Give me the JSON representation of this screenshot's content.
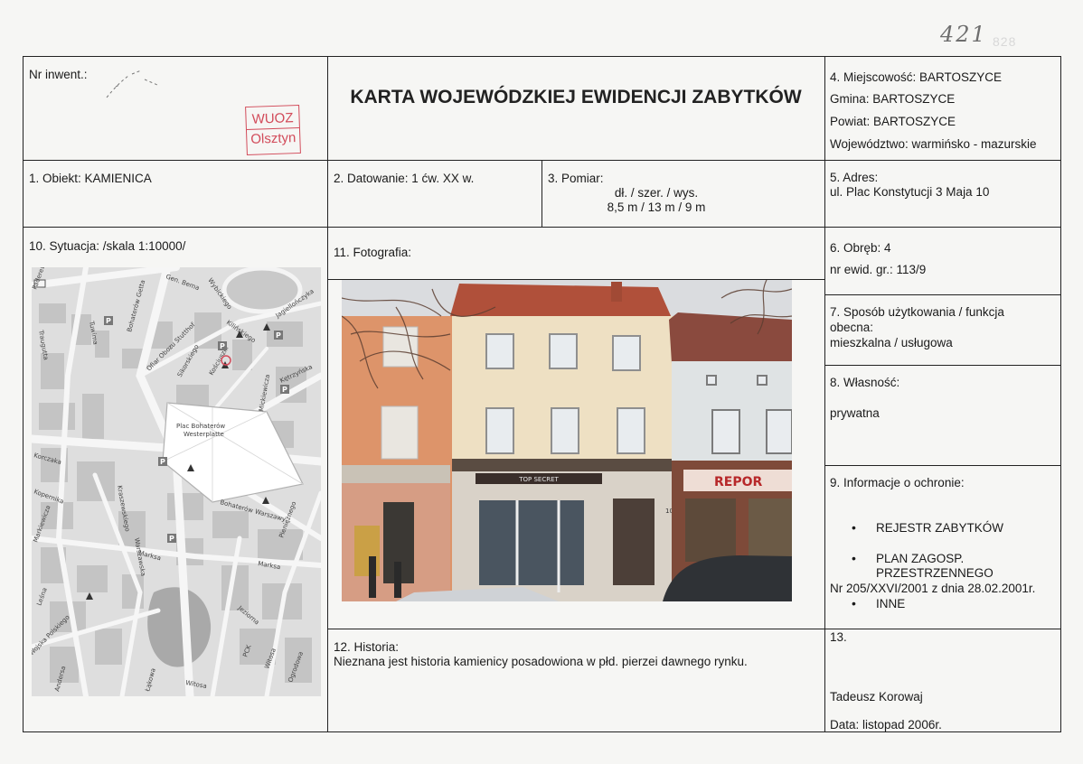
{
  "page_number": "421",
  "page_number_faint": "828",
  "title": "KARTA WOJEWÓDZKIEJ EWIDENCJI ZABYTKÓW",
  "stamp": {
    "line1": "WUOZ",
    "line2": "Olsztyn"
  },
  "inventory": {
    "label": "Nr inwent.:"
  },
  "location": {
    "miejscowosc": "4. Miejscowość: BARTOSZYCE",
    "gmina": "Gmina: BARTOSZYCE",
    "powiat": "Powiat: BARTOSZYCE",
    "wojewodztwo": "Województwo: warmińsko - mazurskie"
  },
  "object": "1. Obiekt: KAMIENICA",
  "dating": "2. Datowanie: 1 ćw. XX w.",
  "measure": {
    "label": "3. Pomiar:",
    "dims_label": "dł. / szer. / wys.",
    "dims_value": "8,5 m / 13 m / 9 m"
  },
  "address": {
    "label": "5. Adres:",
    "value": "ul. Plac Konstytucji 3 Maja 10"
  },
  "situation": "10. Sytuacja: /skala 1:10000/",
  "photo_label": "11. Fotografia:",
  "precinct": {
    "label": "6. Obręb: 4",
    "parcel": "nr ewid. gr.: 113/9"
  },
  "usage": {
    "label_line1": "7. Sposób użytkowania / funkcja",
    "label_line2": "obecna:",
    "value": "mieszkalna / usługowa"
  },
  "ownership": {
    "label": "8. Własność:",
    "value": "prywatna"
  },
  "protection": {
    "label": "9. Informacje o ochronie:",
    "item1": "REJESTR ZABYTKÓW",
    "item2_line1": "PLAN ZAGOSP.",
    "item2_line2": "PRZESTRZENNEGO",
    "resolution": "Nr 205/XXVI/2001 z dnia 28.02.2001r.",
    "item3": "INNE"
  },
  "history": {
    "label": "12. Historia:",
    "text": "Nieznana jest historia kamienicy posadowiona w płd. pierzei dawnego rynku."
  },
  "field13": {
    "label": "13.",
    "author": "Tadeusz Korowaj",
    "date": "Data: listopad 2006r."
  },
  "map": {
    "streets": [
      "Paderewskiego",
      "Gen. Bema",
      "Wybickiego",
      "Kilińskiego",
      "Jagiellończyka",
      "Tuwima",
      "Traugutta",
      "Bohaterów Getta",
      "Ofiar Obozu Stutthof",
      "Sikorskiego",
      "Kościuszki",
      "Kętrzyńska",
      "Mickiewicza",
      "Plac Bohaterów Westerplatte",
      "Korczaka",
      "Bohaterów Warszawy",
      "Kraszewskiego",
      "Kopernika",
      "Jezdna",
      "Warszawska",
      "Markiewicza",
      "Marksa",
      "Leśna",
      "Jeziorna",
      "Pieniężnego",
      "Wojska Polskiego",
      "Andersa",
      "Witosa",
      "PCK",
      "Ogrodowa",
      "Łąkowa"
    ]
  },
  "photo": {
    "shop_sign": "TOP SECRET",
    "shop_sign2": "REPOR",
    "house_number": "10"
  }
}
